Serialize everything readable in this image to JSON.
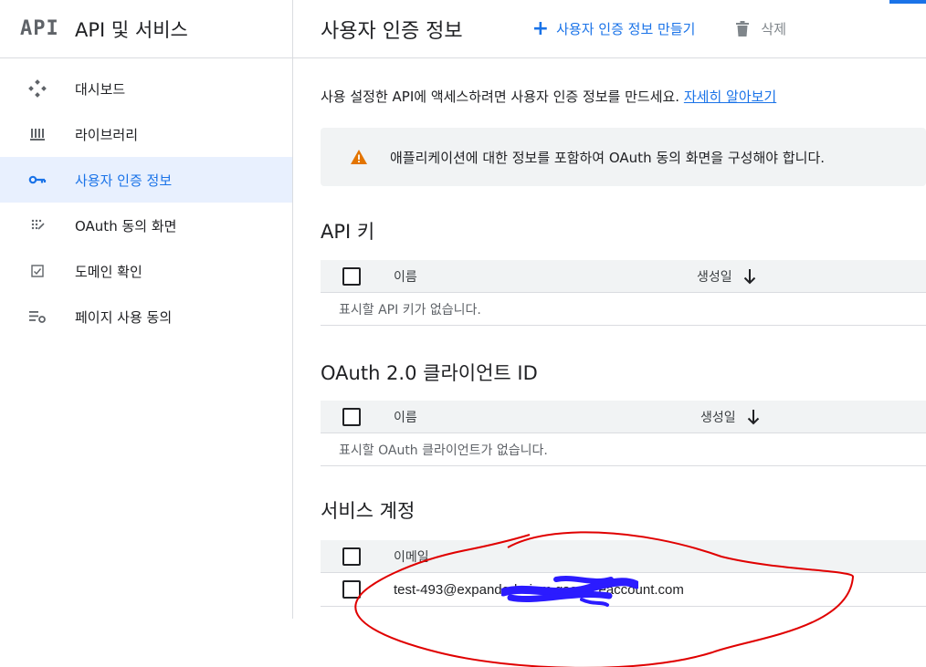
{
  "colors": {
    "accent": "#1a73e8",
    "warning": "#e37400",
    "annotation": "#e00000",
    "scribble": "#2b1bff"
  },
  "sidebar": {
    "logo": "API",
    "title": "API 및 서비스",
    "items": [
      {
        "label": "대시보드",
        "icon": "dashboard-icon"
      },
      {
        "label": "라이브러리",
        "icon": "library-icon"
      },
      {
        "label": "사용자 인증 정보",
        "icon": "key-icon",
        "active": true
      },
      {
        "label": "OAuth 동의 화면",
        "icon": "consent-icon"
      },
      {
        "label": "도메인 확인",
        "icon": "check-box-icon"
      },
      {
        "label": "페이지 사용 동의",
        "icon": "settings-list-icon"
      }
    ]
  },
  "header": {
    "title": "사용자 인증 정보",
    "create_label": "사용자 인증 정보 만들기",
    "delete_label": "삭제"
  },
  "intro": {
    "text": "사용 설정한 API에 액세스하려면 사용자 인증 정보를 만드세요.",
    "link": "자세히 알아보기"
  },
  "warning": {
    "text": "애플리케이션에 대한 정보를 포함하여 OAuth 동의 화면을 구성해야 합니다."
  },
  "api_keys": {
    "title": "API 키",
    "col_name": "이름",
    "col_created": "생성일",
    "empty": "표시할 API 키가 없습니다."
  },
  "oauth_clients": {
    "title": "OAuth 2.0 클라이언트 ID",
    "col_name": "이름",
    "col_created": "생성일",
    "empty": "표시할 OAuth 클라이언트가 없습니다."
  },
  "service_accounts": {
    "title": "서비스 계정",
    "col_email": "이메일",
    "rows": [
      {
        "email": "test-493@expanded-                          .iam.gserviceaccount.com"
      }
    ]
  }
}
